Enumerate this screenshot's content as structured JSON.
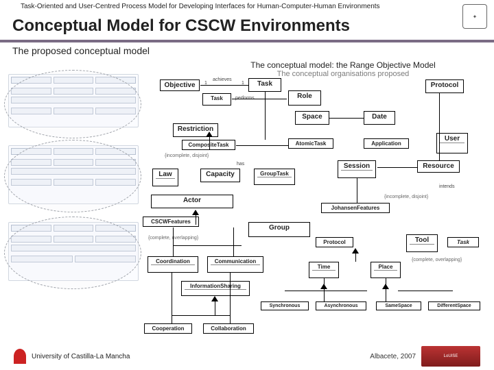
{
  "top_strip": "Task-Oriented and User-Centred Process Model for Developing Interfaces for Human-Computer-Human Environments",
  "main_title": "Conceptual Model for CSCW Environments",
  "sub_bar": "The proposed conceptual model",
  "caption_l1": "The conceptual model: the Range Objective Model",
  "caption_l2": "The conceptual organisations proposed",
  "boxes": {
    "objective": "Objective",
    "task": "Task",
    "role": "Role",
    "protocol": "Protocol",
    "space": "Space",
    "date": "Date",
    "restriction": "Restriction",
    "compositeTask": "CompositeTask",
    "atomicTask": "AtomicTask",
    "application": "Application",
    "user": "User",
    "law": "Law",
    "capacity": "Capacity",
    "groupTask": "GroupTask",
    "session": "Session",
    "resource": "Resource",
    "actor": "Actor",
    "johansen": "JohansenFeatures",
    "cscwFeat": "CSCWFeatures",
    "group": "Group",
    "prot2": "Protocol",
    "tool": "Tool",
    "coord": "Coordination",
    "comm": "Communication",
    "time": "Time",
    "place": "Place",
    "task2": "Task",
    "infoShare": "InformationSharing",
    "sync": "Synchronous",
    "async": "Asynchronous",
    "same": "SameSpace",
    "diff": "DifferentSpace",
    "coop": "Cooperation",
    "collab": "Collaboration"
  },
  "labels": {
    "achieves": "achieves",
    "performs": "performs",
    "has": "has",
    "intends": "intends",
    "incomplete": "{incomplete, disjoint}",
    "overlap": "{complete, overlapping}"
  },
  "footer": {
    "university": "University of Castilla-La Mancha",
    "place": "Albacete, 2007",
    "sponsor": "LoUISE"
  }
}
